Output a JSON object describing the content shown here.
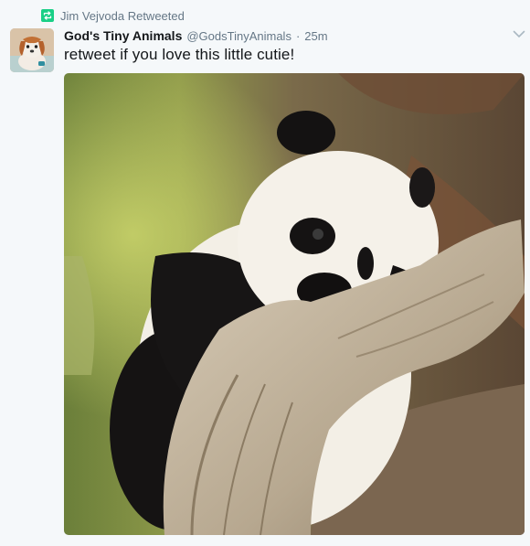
{
  "retweet": {
    "icon": "retweet-icon",
    "text": "Jim Vejvoda Retweeted",
    "color": "#19cf86"
  },
  "tweet": {
    "author_name": "God's Tiny Animals",
    "handle": "@GodsTinyAnimals",
    "separator": "·",
    "time": "25m",
    "text": "retweet if you love this little cutie!",
    "avatar": "avatar-puppy",
    "more_icon": "chevron-down-icon",
    "media": "photo-baby-panda-on-branch"
  },
  "colors": {
    "background": "#f5f8fa",
    "primary_text": "#14171a",
    "secondary_text": "#657786"
  }
}
